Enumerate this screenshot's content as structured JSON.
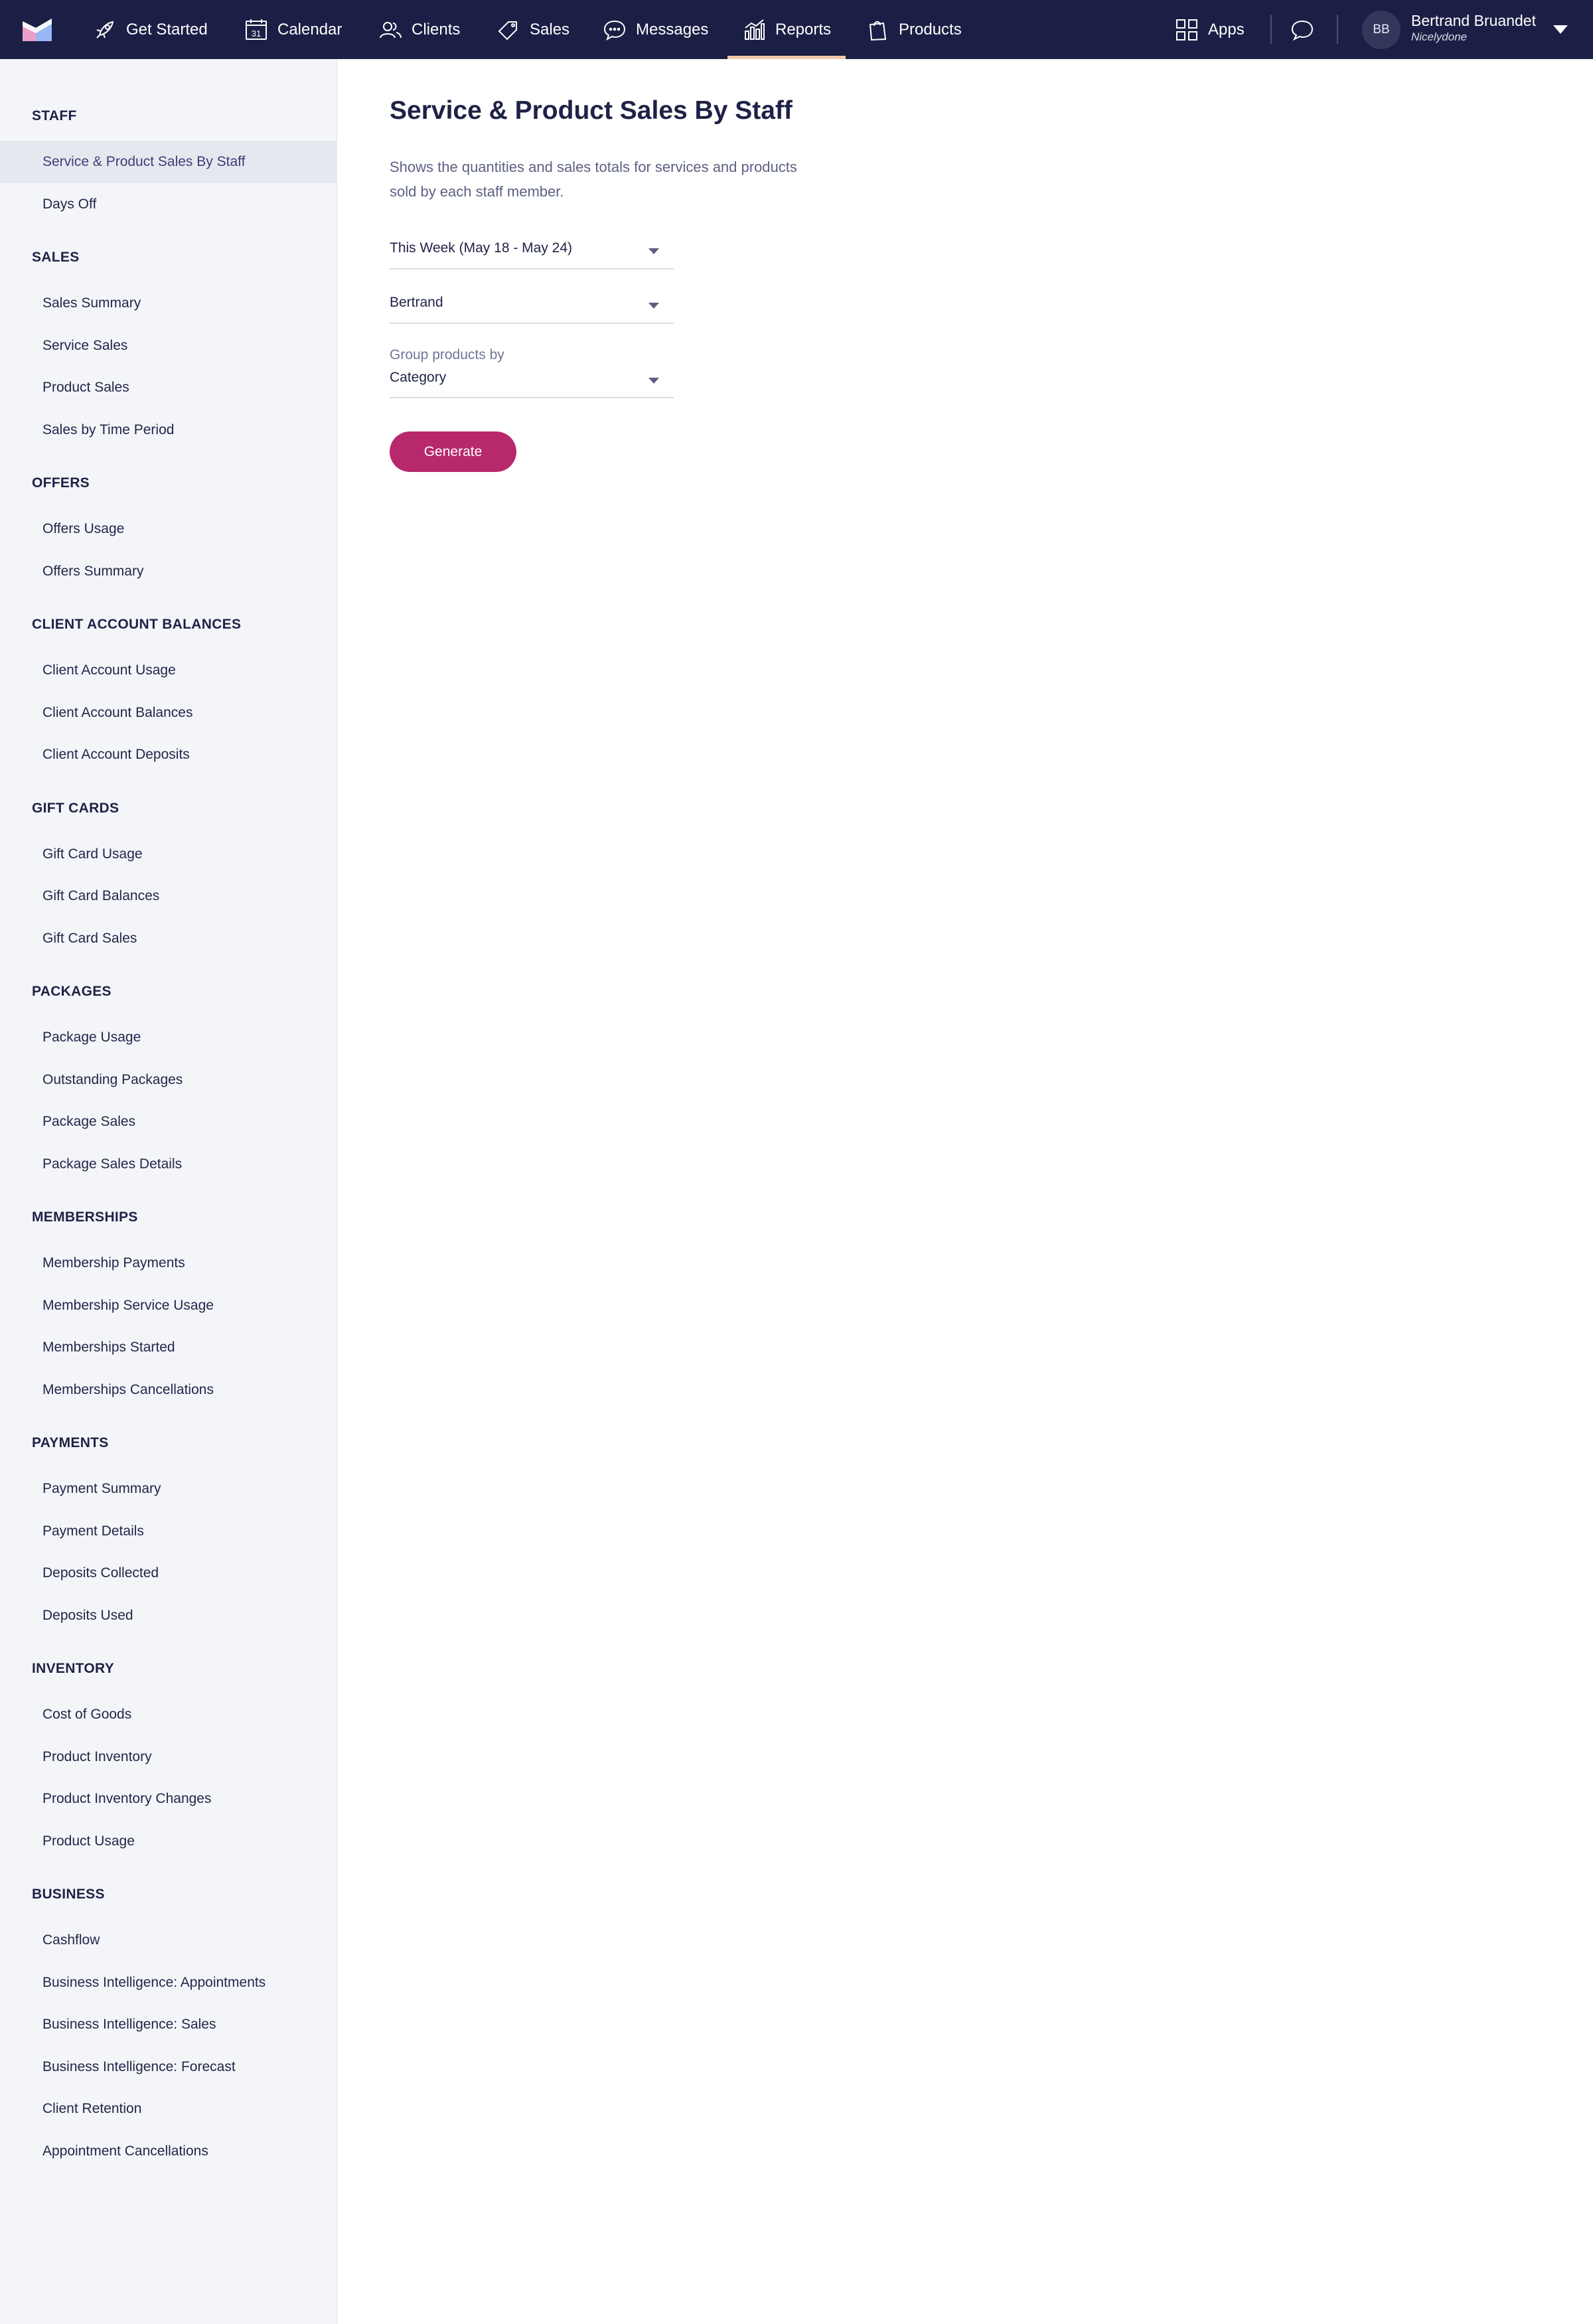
{
  "nav": {
    "items": [
      {
        "label": "Get Started",
        "icon": "rocket-icon"
      },
      {
        "label": "Calendar",
        "icon": "calendar-icon",
        "icon_text": "31"
      },
      {
        "label": "Clients",
        "icon": "clients-icon"
      },
      {
        "label": "Sales",
        "icon": "tag-icon"
      },
      {
        "label": "Messages",
        "icon": "messages-icon"
      },
      {
        "label": "Reports",
        "icon": "bar-chart-icon",
        "active": true
      },
      {
        "label": "Products",
        "icon": "shopping-bag-icon"
      }
    ],
    "apps_label": "Apps",
    "user": {
      "initials": "BB",
      "name": "Bertrand Bruandet",
      "business": "Nicelydone"
    },
    "colors": {
      "background": "#1c1f45",
      "active_underline": "#f4c9a8"
    }
  },
  "sidebar": {
    "sections": [
      {
        "title": "STAFF",
        "items": [
          "Service & Product Sales By Staff",
          "Days Off"
        ]
      },
      {
        "title": "SALES",
        "items": [
          "Sales Summary",
          "Service Sales",
          "Product Sales",
          "Sales by Time Period"
        ]
      },
      {
        "title": "OFFERS",
        "items": [
          "Offers Usage",
          "Offers Summary"
        ]
      },
      {
        "title": "CLIENT ACCOUNT BALANCES",
        "items": [
          "Client Account Usage",
          "Client Account Balances",
          "Client Account Deposits"
        ]
      },
      {
        "title": "GIFT CARDS",
        "items": [
          "Gift Card Usage",
          "Gift Card Balances",
          "Gift Card Sales"
        ]
      },
      {
        "title": "PACKAGES",
        "items": [
          "Package Usage",
          "Outstanding Packages",
          "Package Sales",
          "Package Sales Details"
        ]
      },
      {
        "title": "MEMBERSHIPS",
        "items": [
          "Membership Payments",
          "Membership Service Usage",
          "Memberships Started",
          "Memberships Cancellations"
        ]
      },
      {
        "title": "PAYMENTS",
        "items": [
          "Payment Summary",
          "Payment Details",
          "Deposits Collected",
          "Deposits Used"
        ]
      },
      {
        "title": "INVENTORY",
        "items": [
          "Cost of Goods",
          "Product Inventory",
          "Product Inventory Changes",
          "Product Usage"
        ]
      },
      {
        "title": "BUSINESS",
        "items": [
          "Cashflow",
          "Business Intelligence: Appointments",
          "Business Intelligence: Sales",
          "Business Intelligence: Forecast",
          "Client Retention",
          "Appointment Cancellations"
        ]
      }
    ],
    "active_item": "Service & Product Sales By Staff"
  },
  "main": {
    "title": "Service & Product Sales By Staff",
    "description": "Shows the quantities and sales totals for services and products sold by each staff member.",
    "date_range": "This Week (May 18 - May 24)",
    "staff": "Bertrand",
    "group_label": "Group products by",
    "group_value": "Category",
    "generate_label": "Generate",
    "accent_color": "#b8286c"
  }
}
